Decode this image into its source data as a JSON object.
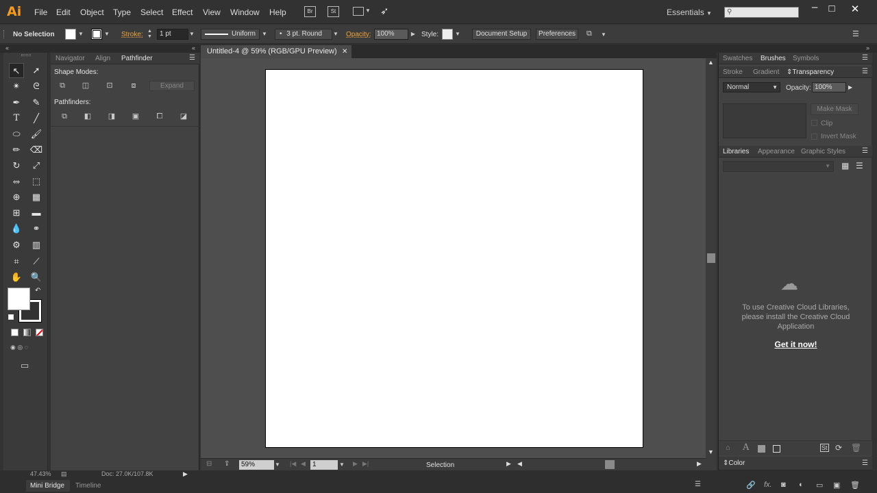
{
  "app": {
    "logo": "Ai"
  },
  "menu": [
    "File",
    "Edit",
    "Object",
    "Type",
    "Select",
    "Effect",
    "View",
    "Window",
    "Help"
  ],
  "menu_icons": {
    "bridge": "Br",
    "stock": "St"
  },
  "workspace": "Essentials",
  "control": {
    "selection": "No Selection",
    "stroke_label": "Stroke:",
    "stroke_weight": "1 pt",
    "profile": "Uniform",
    "brush": "3 pt. Round",
    "opacity_label": "Opacity:",
    "opacity": "100%",
    "style_label": "Style:",
    "doc_setup": "Document Setup",
    "preferences": "Preferences"
  },
  "left_panel": {
    "tabs": [
      "Navigator",
      "Align",
      "Pathfinder"
    ],
    "active_tab": "Pathfinder",
    "shape_modes_label": "Shape Modes:",
    "expand_label": "Expand",
    "pathfinders_label": "Pathfinders:"
  },
  "document": {
    "tab_title": "Untitled-4 @ 59% (RGB/GPU Preview)",
    "zoom": "59%",
    "artboard_num": "1",
    "status_tool": "Selection"
  },
  "right_panel": {
    "group1_tabs": [
      "Swatches",
      "Brushes",
      "Symbols"
    ],
    "group1_active": "Brushes",
    "group2_tabs": [
      "Stroke",
      "Gradient",
      "Transparency"
    ],
    "group2_active": "Transparency",
    "blend_mode": "Normal",
    "opacity_label": "Opacity:",
    "opacity": "100%",
    "make_mask": "Make Mask",
    "clip": "Clip",
    "invert_mask": "Invert Mask",
    "group3_tabs": [
      "Libraries",
      "Appearance",
      "Graphic Styles"
    ],
    "group3_active": "Libraries",
    "cc_message": "To use Creative Cloud Libraries, please install the Creative Cloud Application",
    "get_it": "Get it now!",
    "color_tab": "Color"
  },
  "bottom": {
    "zoom_readout": "47.43%",
    "doc_size": "Doc: 27.0K/107.8K",
    "tabs": [
      "Mini Bridge",
      "Timeline"
    ],
    "active_tab": "Mini Bridge"
  }
}
